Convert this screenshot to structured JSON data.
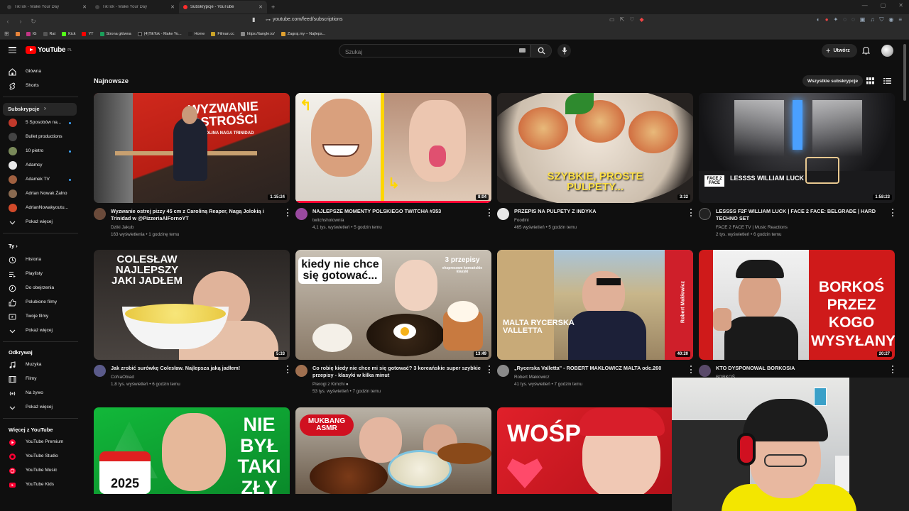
{
  "browser": {
    "tabs": [
      {
        "title": "TikTok - Make Your Day",
        "active": false
      },
      {
        "title": "TikTok - Make Your Day",
        "active": false
      },
      {
        "title": "Subskrypcje - YouTube",
        "active": true
      }
    ],
    "url": "youtube.com/feed/subscriptions",
    "bookmarks": [
      "IG",
      "Rat",
      "Kick",
      "YT",
      "Strona główna",
      "(4)TikTok - Make Yo...",
      "Home",
      "Filman.cc",
      "https://tangle.io/",
      "Zagraj.my – Najleps..."
    ]
  },
  "header": {
    "logo_text": "YouTube",
    "logo_suffix": "PL",
    "search_placeholder": "Szukaj",
    "create_label": "Utwórz"
  },
  "sidebar": {
    "main_items": [
      {
        "label": "Główna",
        "icon": "home-icon"
      },
      {
        "label": "Shorts",
        "icon": "shorts-icon"
      }
    ],
    "subscriptions_heading": "Subskrypcje",
    "subscriptions": [
      {
        "label": "5 Sposobów na...",
        "new": true,
        "color": "#c0392b"
      },
      {
        "label": "Bullet productions",
        "new": false,
        "color": "#444444"
      },
      {
        "label": "10 pietro",
        "new": true,
        "color": "#7a8a5a"
      },
      {
        "label": "Adamcy",
        "new": false,
        "color": "#e8e8e8"
      },
      {
        "label": "Adamek TV",
        "new": true,
        "color": "#a06040"
      },
      {
        "label": "Adrian Nowak Żalno",
        "new": false,
        "color": "#8a6a50"
      },
      {
        "label": "AdrianNowakyoutu...",
        "new": false,
        "color": "#d24a2a"
      }
    ],
    "subs_more": "Pokaż więcej",
    "you_heading": "Ty",
    "you_items": [
      {
        "label": "Historia",
        "icon": "history-icon"
      },
      {
        "label": "Playlisty",
        "icon": "playlist-icon"
      },
      {
        "label": "Do obejrzenia",
        "icon": "watch-later-icon"
      },
      {
        "label": "Polubione filmy",
        "icon": "like-icon"
      },
      {
        "label": "Twoje filmy",
        "icon": "your-videos-icon"
      },
      {
        "label": "Pokaż więcej",
        "icon": "chevron-down-icon"
      }
    ],
    "explore_heading": "Odkrywaj",
    "explore_items": [
      {
        "label": "Muzyka",
        "icon": "music-icon"
      },
      {
        "label": "Filmy",
        "icon": "film-icon"
      },
      {
        "label": "Na żywo",
        "icon": "live-icon"
      },
      {
        "label": "Pokaż więcej",
        "icon": "chevron-down-icon"
      }
    ],
    "more_heading": "Więcej z YouTube",
    "more_items": [
      {
        "label": "YouTube Premium"
      },
      {
        "label": "YouTube Studio"
      },
      {
        "label": "YouTube Music"
      },
      {
        "label": "YouTube Kids"
      }
    ]
  },
  "main": {
    "section_title": "Najnowsze",
    "all_subs_button": "Wszystkie subskrypcje",
    "videos": [
      {
        "title": "Wyzwanie ostrej pizzy 45 cm z Caroliną Reaper, Nagą Jolokią i Trinidad w @PizzeriaAlFornoYT",
        "channel": "Dziki Jakub",
        "meta": "163 wyświetlenia • 1 godzinę temu",
        "duration": "1:15:24",
        "thumb_text": "WYZWANIE OSTROŚCI",
        "ava": "#6a4a3a"
      },
      {
        "title": "NAJLEPSZE MOMENTY POLSKIEGO TWITCHA #353",
        "channel": "twitchshotownia",
        "meta": "4,1 tys. wyświetleń • 5 godzin temu",
        "duration": "8:04",
        "thumb_text": "",
        "ava": "#9a4aa0"
      },
      {
        "title": "PRZEPIS NA PULPETY Z INDYKA",
        "channel": "Foodini",
        "meta": "465 wyświetleń • 5 godzin temu",
        "duration": "3:32",
        "thumb_text": "SZYBKIE, PROSTE PULPETY...",
        "ava": "#e8e8e8"
      },
      {
        "title": "LESSSS F2F WILLIAM LUCK | FACE 2 FACE: BELGRADE | HARD TECHNO SET",
        "channel": "FACE 2 FACE TV | Music Reactions",
        "meta": "2 tys. wyświetleń • 6 godzin temu",
        "duration": "1:58:23",
        "thumb_text": "LESSSS WILLIAM LUCK",
        "ava": "#222222"
      },
      {
        "title": "Jak zrobić surówkę Colesław. Najlepsza jaką jadłem!",
        "channel": "CoNaObiad",
        "meta": "1,8 tys. wyświetleń • 6 godzin temu",
        "duration": "5:33",
        "thumb_text": "COLESŁAW NAJLEPSZY JAKI JADŁEM",
        "ava": "#5a5a8a"
      },
      {
        "title": "Co robię kiedy nie chce mi się gotować? 3 koreańskie super szybkie przepisy - klasyki w kilka minut",
        "channel": "Pierogi z Kimchi",
        "meta": "53 tys. wyświetleń • 7 godzin temu",
        "duration": "13:49",
        "thumb_text": "kiedy nie chce się gotować...",
        "ava": "#a07050"
      },
      {
        "title": "„Rycerska Valletta\" - ROBERT MAKŁOWICZ MALTA odc.260",
        "channel": "Robert Makłowicz",
        "meta": "41 tys. wyświetleń • 7 godzin temu",
        "duration": "40:20",
        "thumb_text": "MALTA RYCERSKA VALLETTA",
        "ava": "#8a8a8a"
      },
      {
        "title": "KTO DYSPONOWAŁ BORKOSIA",
        "channel": "BORKOŚ",
        "meta": "",
        "duration": "20:27",
        "thumb_text": "BORKOŚ PRZEZ KOGO WYSYŁANY",
        "ava": "#5a4a6a"
      },
      {
        "title": "",
        "channel": "",
        "meta": "",
        "duration": "",
        "thumb_text": "NIE BYŁ TAKI ZŁY",
        "ava": "#333333"
      },
      {
        "title": "",
        "channel": "",
        "meta": "",
        "duration": "",
        "thumb_text": "MUKBANG ASMR",
        "ava": "#333333"
      },
      {
        "title": "",
        "channel": "",
        "meta": "",
        "duration": "",
        "thumb_text": "WOŚP",
        "ava": "#333333"
      }
    ]
  },
  "extra_texts": {
    "v2_thumb_extra": "3 przepisy",
    "v2_thumb_sub": "ekspresowe koreańskie klasyki",
    "v3_side": "Robert Makłowicz",
    "v3_face": "FACE 2 FACE",
    "v8_year": "2025",
    "v0_sub": "CAROLINA NAGA TRINIDAD"
  },
  "colors": {
    "accent": "#ff0000",
    "background": "#0f0f0f",
    "new_dot": "#3ea6ff"
  }
}
